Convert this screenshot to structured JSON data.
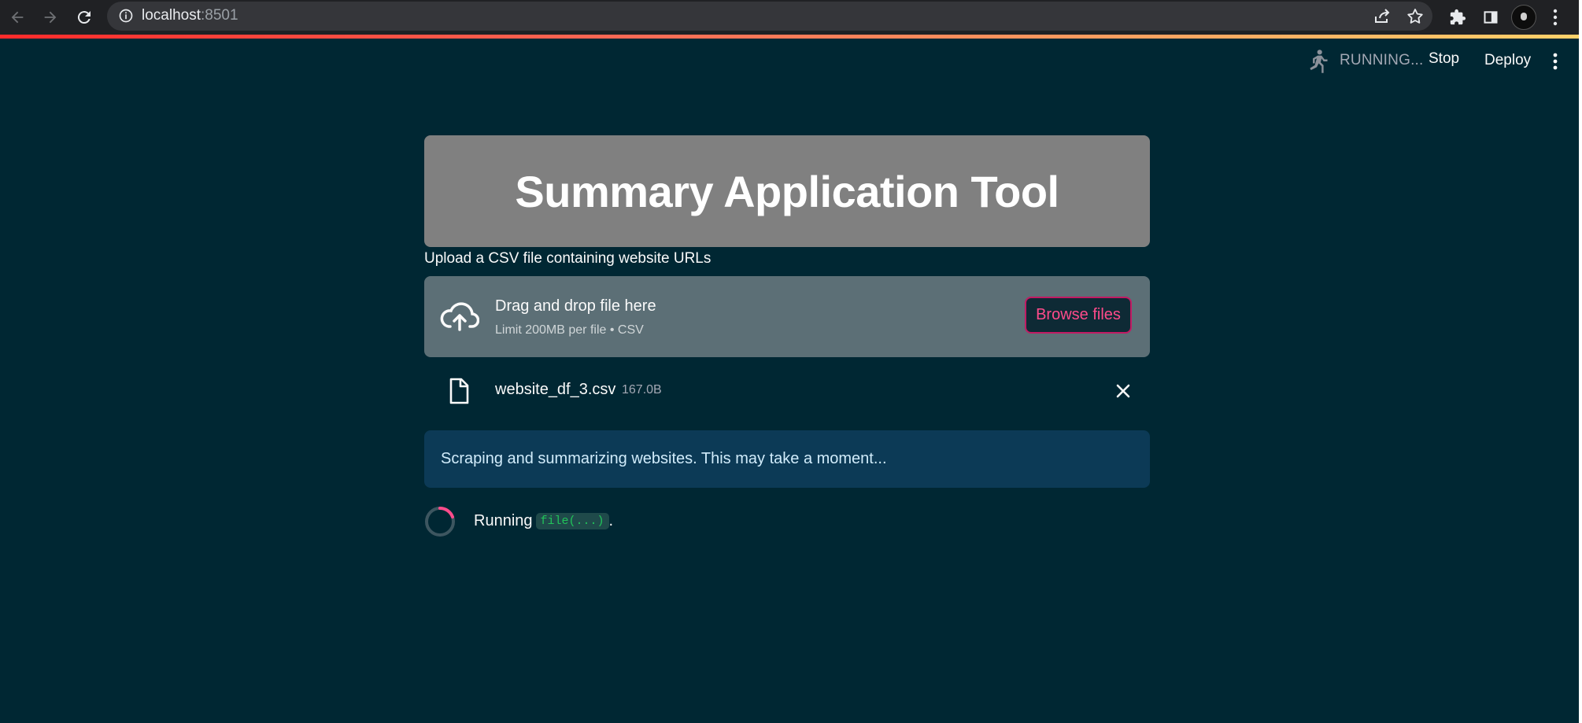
{
  "browser": {
    "url_host": "localhost",
    "url_port": ":8501"
  },
  "header": {
    "status": "RUNNING...",
    "stop_label": "Stop",
    "deploy_label": "Deploy"
  },
  "main": {
    "title": "Summary Application Tool",
    "uploader_label": "Upload a CSV file containing website URLs",
    "dropzone": {
      "title": "Drag and drop file here",
      "subtitle": "Limit 200MB per file • CSV",
      "browse_label": "Browse files"
    },
    "uploaded_file": {
      "name": "website_df_3.csv",
      "size": "167.0B"
    },
    "info_message": "Scraping and summarizing websites. This may take a moment...",
    "spinner": {
      "prefix": "Running",
      "code": "file(...)",
      "suffix": "."
    }
  },
  "colors": {
    "background": "#002733",
    "title_box": "#808080",
    "dropzone": "#5c6f76",
    "info_box": "#0c3a56",
    "accent": "#ff4b8b"
  },
  "icons": [
    "back-icon",
    "forward-icon",
    "reload-icon",
    "info-icon",
    "share-icon",
    "star-icon",
    "puzzle-icon",
    "sidepanel-icon",
    "kebab-menu-icon",
    "running-man-icon",
    "cloud-upload-icon",
    "file-icon",
    "close-icon",
    "spinner-icon"
  ]
}
